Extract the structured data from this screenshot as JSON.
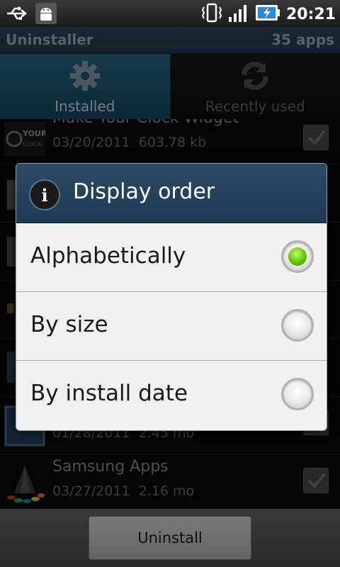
{
  "status_bar": {
    "time": "20:21",
    "icons": [
      "usb-icon",
      "android-debug-icon",
      "vibrate-icon",
      "signal-icon",
      "battery-charging-icon"
    ]
  },
  "title_bar": {
    "title": "Uninstaller",
    "count": "35 apps"
  },
  "tabs": [
    {
      "label": "Installed",
      "icon": "gear-icon",
      "active": true
    },
    {
      "label": "Recently used",
      "icon": "refresh-icon",
      "active": false
    }
  ],
  "apps": [
    {
      "name": "Make Your Clock Widget",
      "date": "03/20/2011",
      "size": "603.78 kb",
      "checked": true
    },
    {
      "name": "",
      "date": "",
      "size": "",
      "checked": false
    },
    {
      "name": "",
      "date": "",
      "size": "",
      "checked": false
    },
    {
      "name": "",
      "date": "",
      "size": "",
      "checked": true
    },
    {
      "name": "",
      "date": "",
      "size": "",
      "checked": true
    },
    {
      "name": "",
      "date": "01/28/2011",
      "size": "2.45 mo",
      "checked": true
    },
    {
      "name": "Samsung Apps",
      "date": "03/27/2011",
      "size": "2.16 mo",
      "checked": true
    }
  ],
  "dialog": {
    "title": "Display order",
    "info_glyph": "i",
    "options": [
      {
        "label": "Alphabetically",
        "selected": true
      },
      {
        "label": "By size",
        "selected": false
      },
      {
        "label": "By install date",
        "selected": false
      }
    ]
  },
  "bottom": {
    "uninstall_label": "Uninstall"
  },
  "colors": {
    "accent_green": "#6ac400",
    "title_bar": "#2f4b62",
    "active_tab": "#2a6a8a"
  }
}
